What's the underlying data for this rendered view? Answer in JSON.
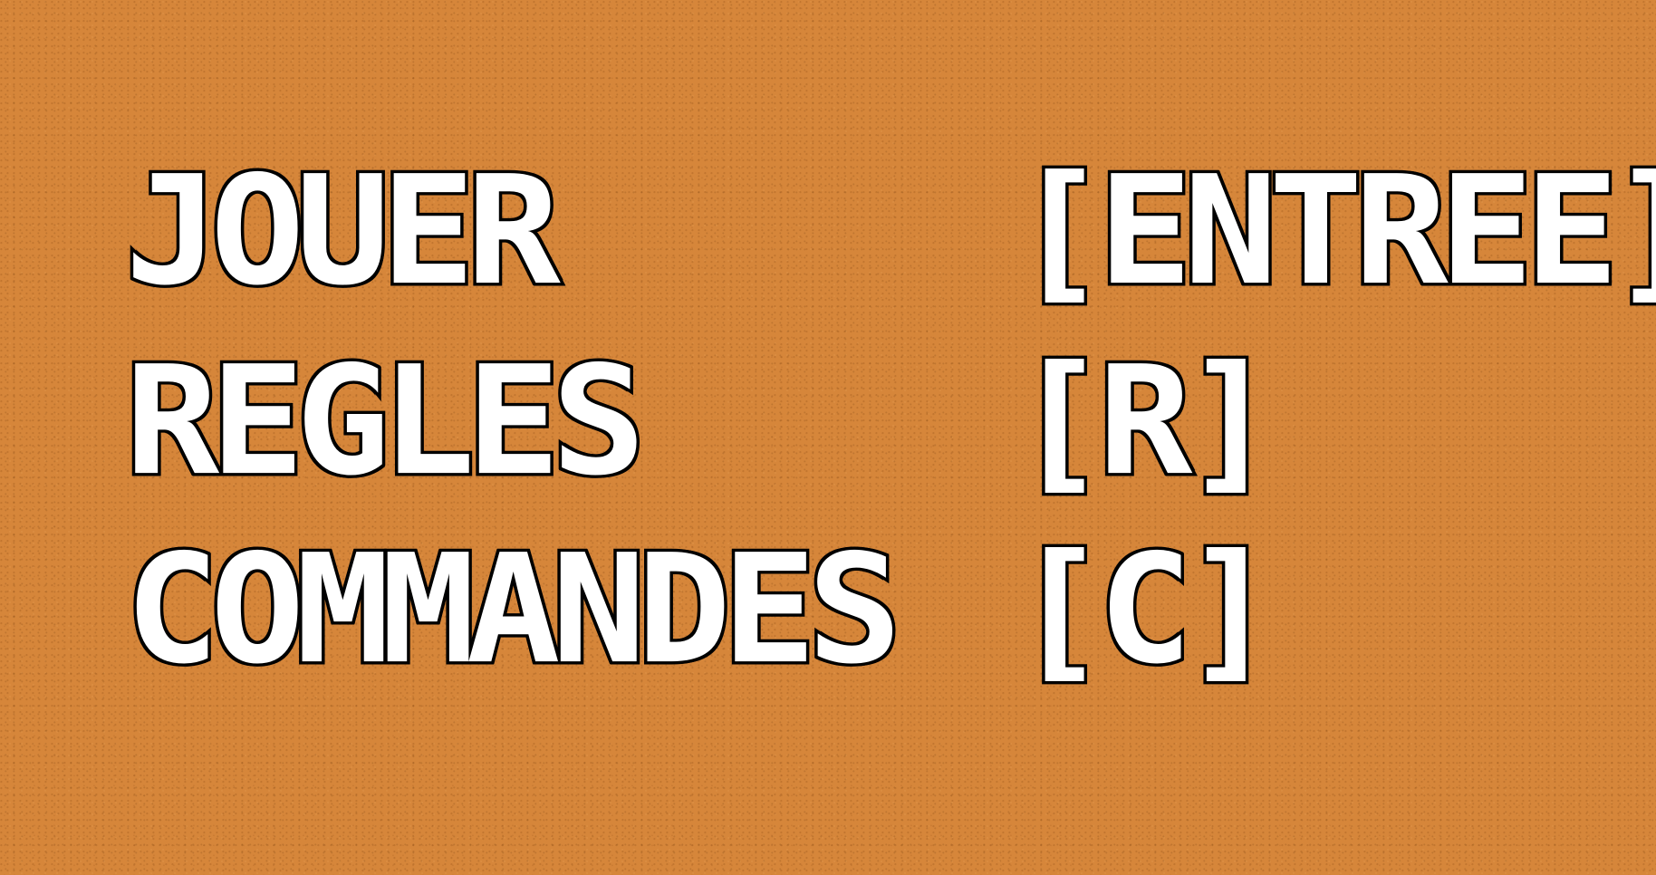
{
  "menu": {
    "items": [
      {
        "label": "JOUER",
        "key": "[ENTREE]"
      },
      {
        "label": "REGLES",
        "key": "[R]"
      },
      {
        "label": "COMMANDES",
        "key": "[C]"
      }
    ]
  },
  "colors": {
    "background": "#d6863a",
    "text": "#ffffff",
    "outline": "#000000"
  }
}
